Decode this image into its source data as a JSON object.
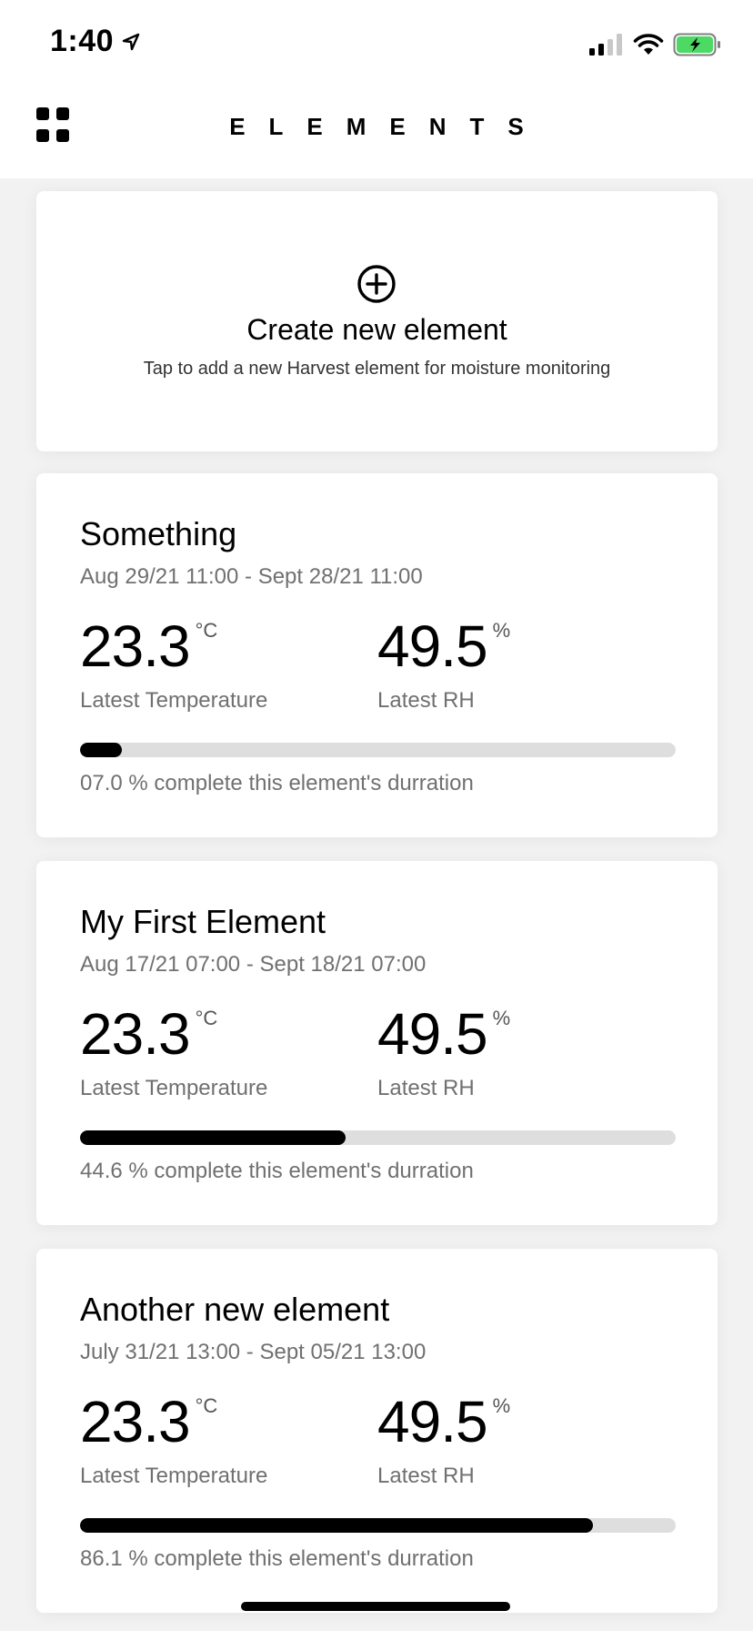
{
  "status_bar": {
    "time": "1:40",
    "location_icon": "location-arrow-icon",
    "signal_icon": "cellular-signal-icon",
    "wifi_icon": "wifi-icon",
    "battery_icon": "battery-charging-icon"
  },
  "header": {
    "title": "ELEMENTS",
    "menu_icon": "grid-menu-icon"
  },
  "create_card": {
    "icon": "plus-circle-icon",
    "title": "Create new element",
    "subtitle": "Tap to add a new Harvest element for moisture monitoring"
  },
  "elements": [
    {
      "name": "Something",
      "dates": "Aug 29/21 11:00 - Sept 28/21 11:00",
      "temperature": "23.3",
      "temperature_unit": "°C",
      "temperature_label": "Latest Temperature",
      "rh": "49.5",
      "rh_unit": "%",
      "rh_label": "Latest RH",
      "progress": 7.0,
      "progress_text": "07.0 % complete this element's durration"
    },
    {
      "name": "My First Element",
      "dates": "Aug 17/21 07:00 - Sept 18/21 07:00",
      "temperature": "23.3",
      "temperature_unit": "°C",
      "temperature_label": "Latest Temperature",
      "rh": "49.5",
      "rh_unit": "%",
      "rh_label": "Latest RH",
      "progress": 44.6,
      "progress_text": "44.6 % complete this element's durration"
    },
    {
      "name": "Another new element",
      "dates": "July 31/21 13:00 - Sept 05/21 13:00",
      "temperature": "23.3",
      "temperature_unit": "°C",
      "temperature_label": "Latest Temperature",
      "rh": "49.5",
      "rh_unit": "%",
      "rh_label": "Latest RH",
      "progress": 86.1,
      "progress_text": "86.1 % complete this element's durration"
    }
  ],
  "colors": {
    "background": "#f2f2f2",
    "card": "#ffffff",
    "progress_fill": "#000000",
    "progress_track": "#dedede",
    "battery": "#4cd964",
    "secondary_text": "#707070"
  }
}
